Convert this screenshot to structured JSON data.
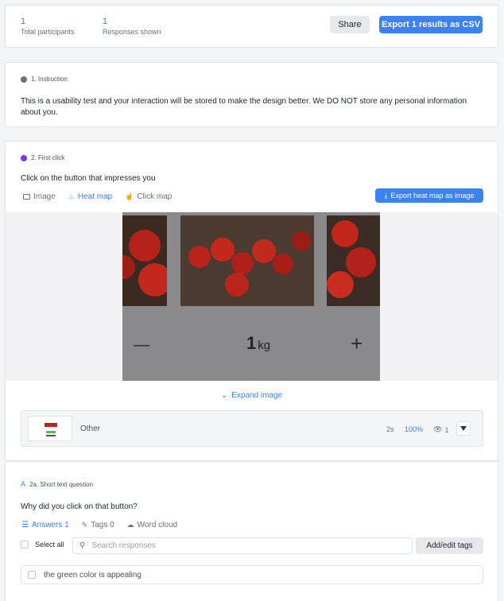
{
  "summary": {
    "participants_count": "1",
    "participants_label": "Total participants",
    "responses_count": "1",
    "responses_label": "Responses shown",
    "share_label": "Share",
    "export_csv_label": "Export 1 results as CSV"
  },
  "instruction": {
    "heading": "1. Instruction",
    "text": "This is a usability test and your interaction will be stored to make the design better. We DO NOT store any personal information about you."
  },
  "first_click": {
    "heading": "2. First click",
    "question": "Click on the button that impresses you",
    "tabs": [
      "Image",
      "Heat map",
      "Click map"
    ],
    "active_tab": "Heat map",
    "export_label": "Export heat map as image",
    "quantity_number": "1",
    "quantity_unit": "kg",
    "minus": "—",
    "plus": "+",
    "expand_label": "Expand image",
    "result": {
      "label": "Other",
      "time": "2s",
      "percent": "100%",
      "views": "1"
    }
  },
  "short_text": {
    "heading": "2a. Short text question",
    "question": "Why did you click on that button?",
    "tabs": [
      "Answers 1",
      "Tags 0",
      "Word cloud"
    ],
    "active_tab": "Answers 1",
    "select_all_label": "Select all",
    "search_placeholder": "Search responses",
    "add_tags_label": "Add/edit tags",
    "answers": [
      "the green color is appealing"
    ]
  },
  "colors": {
    "accent": "#3b82f6",
    "purple": "#7c3aed"
  }
}
